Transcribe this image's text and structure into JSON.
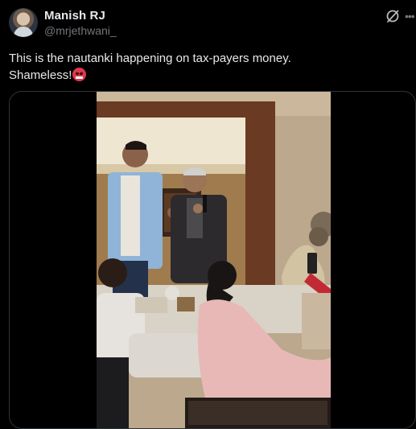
{
  "author": {
    "display_name": "Manish RJ",
    "handle": "@mrjethwani_"
  },
  "icons": {
    "grok": "grok-icon",
    "more": "more-icon",
    "emoji": "pouting-face-emoji"
  },
  "tweet": {
    "line1": "This is the nautanki happening on tax-payers money.",
    "line2": "Shameless!"
  },
  "colors": {
    "background": "#000000",
    "text": "#e7e9ea",
    "secondary_text": "#71767b",
    "border": "#2f3336"
  }
}
